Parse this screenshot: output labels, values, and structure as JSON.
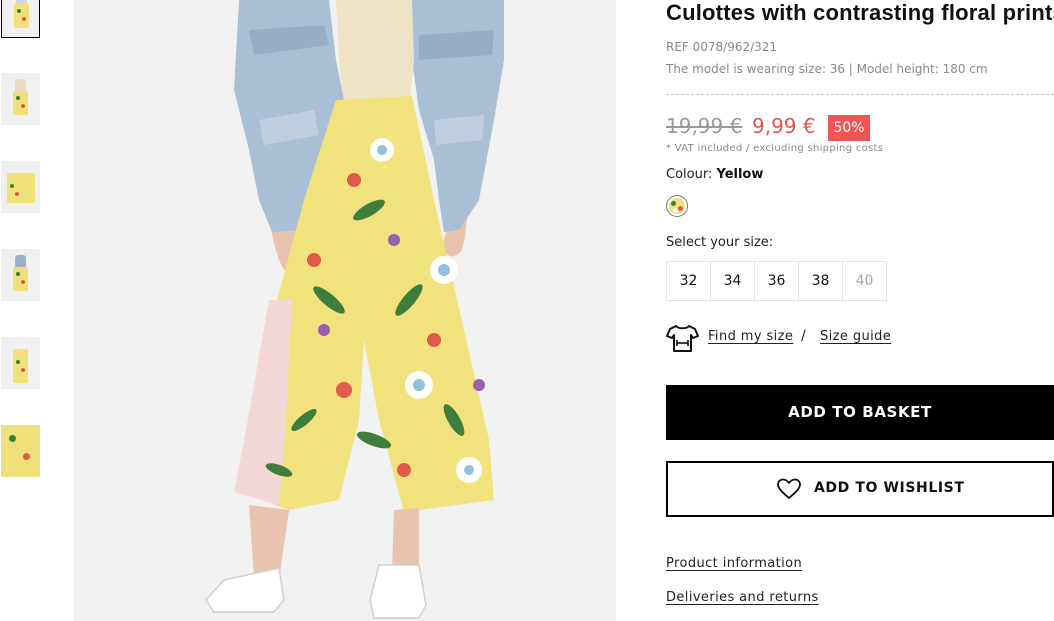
{
  "thumbnails": [
    {
      "label": "Thumbnail 1",
      "active": true
    },
    {
      "label": "Thumbnail 2",
      "active": false
    },
    {
      "label": "Thumbnail 3",
      "active": false
    },
    {
      "label": "Thumbnail 4",
      "active": false
    },
    {
      "label": "Thumbnail 5",
      "active": false
    },
    {
      "label": "Thumbnail 6",
      "active": false
    }
  ],
  "product": {
    "title": "Culottes with contrasting floral prints",
    "ref": "REF 0078/962/321",
    "model_info": "The model is wearing size: 36 | Model height: 180 cm",
    "old_price": "19,99 €",
    "new_price": "9,99 €",
    "discount": "50%",
    "vat_note": "* VAT included / excluding shipping costs",
    "colour_label": "Colour:",
    "colour_value": "Yellow",
    "colour_swatch": "#f1e27d",
    "size_prompt": "Select your size:",
    "sizes": [
      {
        "label": "32",
        "available": true
      },
      {
        "label": "34",
        "available": true
      },
      {
        "label": "36",
        "available": true
      },
      {
        "label": "38",
        "available": true
      },
      {
        "label": "40",
        "available": false
      }
    ],
    "find_my_size": "Find my size",
    "separator": "/",
    "size_guide": "Size guide"
  },
  "actions": {
    "add_to_basket": "ADD TO BASKET",
    "add_to_wishlist": "ADD TO WISHLIST"
  },
  "info_links": {
    "product_information": "Product information",
    "deliveries_returns": "Deliveries and returns"
  },
  "icons": {
    "tshirt": "tshirt-icon",
    "heart": "heart-icon"
  },
  "colors": {
    "accent_price": "#e8524f",
    "discount_badge": "#ee5555",
    "primary_button": "#000000"
  }
}
